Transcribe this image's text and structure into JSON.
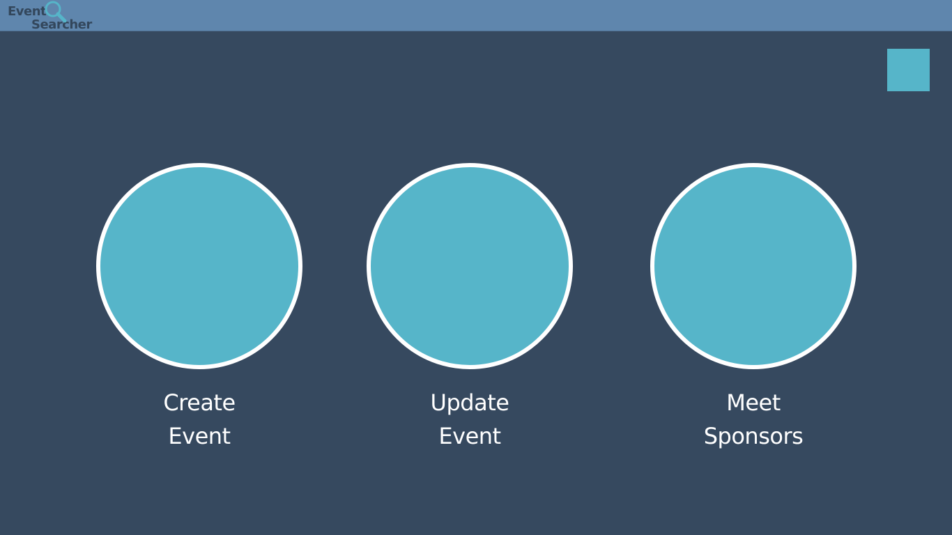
{
  "header": {
    "logo": {
      "word1": "Event",
      "word2": "Searcher",
      "icon": "magnifier-icon"
    }
  },
  "corner_button": {
    "color": "#56b5c9"
  },
  "tiles": [
    {
      "line1": "Create",
      "line2": "Event"
    },
    {
      "line1": "Update",
      "line2": "Event"
    },
    {
      "line1": "Meet",
      "line2": "Sponsors"
    }
  ],
  "colors": {
    "background": "#36495f",
    "topbar": "#5f86ad",
    "accent": "#56b5c9",
    "circle_border": "#ffffff",
    "text": "#ffffff"
  }
}
